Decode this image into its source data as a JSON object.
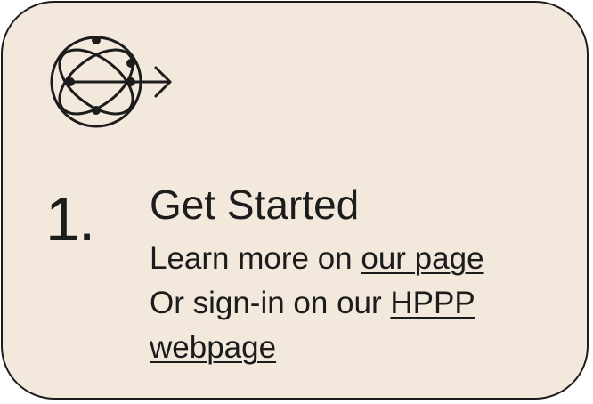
{
  "card": {
    "step_number": "1.",
    "title": "Get Started",
    "line1_text": "Learn more on ",
    "line1_link": "our page",
    "line2_text": "Or sign-in on our ",
    "line2_link": "HPPP",
    "line3_link": "webpage",
    "icon": "globe-arrow-icon"
  },
  "colors": {
    "background": "#f2e9dc",
    "ink": "#1c1c1c"
  }
}
